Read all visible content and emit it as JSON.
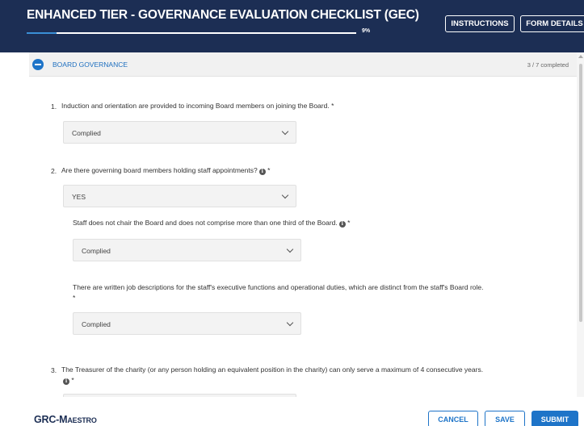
{
  "header": {
    "title": "ENHANCED TIER - GOVERNANCE EVALUATION CHECKLIST (GEC)",
    "progress_label": "9%",
    "progress_fraction": 0.09,
    "instructions_label": "INSTRUCTIONS",
    "form_details_label": "FORM DETAILS"
  },
  "section": {
    "title": "BOARD GOVERNANCE",
    "completed": "3 / 7 completed"
  },
  "questions": [
    {
      "number": "1.",
      "text": "Induction and orientation are provided to incoming Board members on joining the Board.",
      "required": "*",
      "answer": "Complied"
    },
    {
      "number": "2.",
      "text": "Are there governing board members holding staff appointments?",
      "required": "*",
      "answer": "YES",
      "sub_questions": [
        {
          "text": "Staff does not chair the Board and does not comprise more than one third of the Board.",
          "required": "*",
          "answer": "Complied"
        },
        {
          "text": "There are written job descriptions for the staff's executive functions and operational duties, which are distinct from the staff's Board role.",
          "required": "*",
          "answer": "Complied"
        }
      ]
    },
    {
      "number": "3.",
      "text": "The Treasurer of the charity (or any person holding an equivalent position in the charity) can only serve a maximum of 4 consecutive years.",
      "required": "*"
    }
  ],
  "icons": {
    "info": "i"
  },
  "footer": {
    "logo_part1": "GRC-",
    "logo_part2": "Maestro",
    "cancel_label": "CANCEL",
    "save_label": "SAVE",
    "submit_label": "SUBMIT"
  },
  "colors": {
    "header_bg": "#1c2e54",
    "accent": "#1e74c8"
  }
}
